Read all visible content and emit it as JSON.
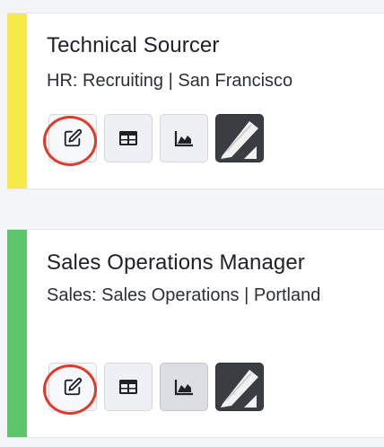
{
  "cards": [
    {
      "title": "Technical Sourcer",
      "subtitle": "HR: Recruiting | San Francisco",
      "stripe_color": "#f5ea4a",
      "actions": {
        "edit_icon": "edit-icon",
        "table_icon": "table-icon",
        "chart_icon": "area-chart-icon",
        "sign_icon": "signature-icon"
      }
    },
    {
      "title": "Sales Operations Manager",
      "subtitle": "Sales: Sales Operations | Portland",
      "stripe_color": "#5cc46a",
      "actions": {
        "edit_icon": "edit-icon",
        "table_icon": "table-icon",
        "chart_icon": "area-chart-icon",
        "sign_icon": "signature-icon"
      }
    }
  ],
  "colors": {
    "highlight": "#e23a2a",
    "background": "#f4f5f8"
  }
}
